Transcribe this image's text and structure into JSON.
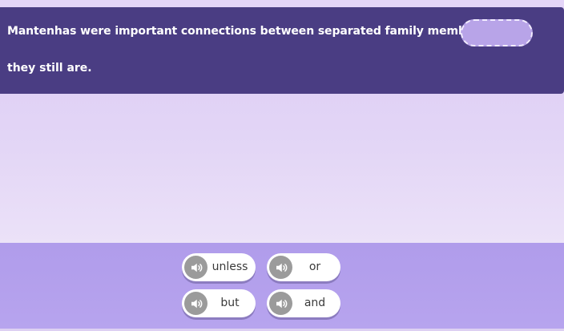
{
  "question": {
    "sentence_part1": "Mantenhas were important connections between separated family members",
    "sentence_part2": "they still are."
  },
  "answer_options": [
    {
      "label": "unless",
      "audio_icon": "speaker-icon"
    },
    {
      "label": "or",
      "audio_icon": "speaker-icon"
    },
    {
      "label": "but",
      "audio_icon": "speaker-icon"
    },
    {
      "label": "and",
      "audio_icon": "speaker-icon"
    }
  ],
  "colors": {
    "panel": "#4a3d83",
    "blank_slot": "#b8a4e8",
    "tray": "#b09ceb",
    "chip": "#ffffff",
    "speaker": "#9b9b9b"
  }
}
